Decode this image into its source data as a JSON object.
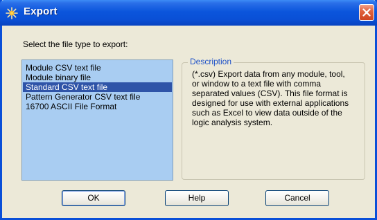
{
  "window": {
    "title": "Export"
  },
  "prompt": "Select the file type to export:",
  "file_types": [
    {
      "label": "Module CSV text file",
      "selected": false
    },
    {
      "label": "Module binary file",
      "selected": false
    },
    {
      "label": "Standard CSV text file",
      "selected": true
    },
    {
      "label": "Pattern Generator CSV text file",
      "selected": false
    },
    {
      "label": "16700 ASCII File Format",
      "selected": false
    }
  ],
  "description": {
    "label": "Description",
    "text": " (*.csv) Export data from any module, tool,\nor window to a text file with comma\nseparated values (CSV).  This file format is\ndesigned for use with external applications\nsuch as Excel to view data outside of the\nlogic analysis system."
  },
  "buttons": {
    "ok": "OK",
    "help": "Help",
    "cancel": "Cancel"
  },
  "colors": {
    "titlebar": "#0a50d6",
    "dialog_bg": "#ece9d8",
    "list_bg": "#a9cdf2",
    "selection": "#2f54a8",
    "close_button": "#e0633f"
  }
}
